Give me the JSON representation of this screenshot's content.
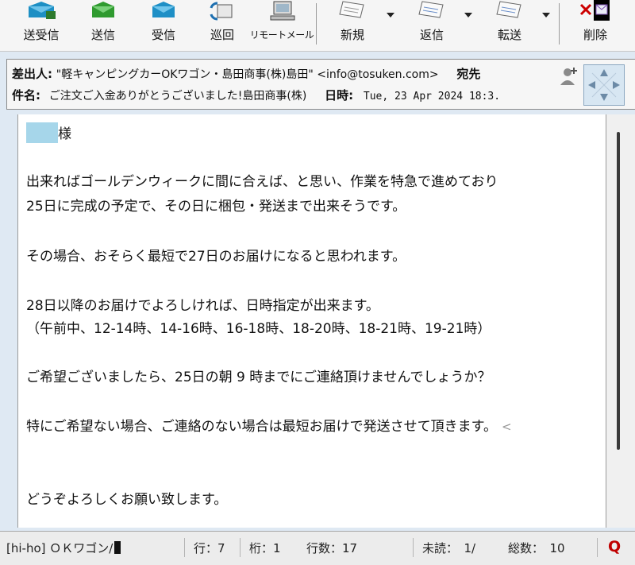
{
  "toolbar": {
    "buttons": [
      {
        "label": "送受信",
        "icon": "send-receive-icon"
      },
      {
        "label": "送信",
        "icon": "send-icon"
      },
      {
        "label": "受信",
        "icon": "receive-icon"
      },
      {
        "label": "巡回",
        "icon": "patrol-icon"
      },
      {
        "label": "リモートメール",
        "icon": "remote-mail-icon"
      },
      {
        "label": "新規",
        "icon": "new-mail-icon"
      },
      {
        "label": "返信",
        "icon": "reply-icon"
      },
      {
        "label": "転送",
        "icon": "forward-icon"
      },
      {
        "label": "削除",
        "icon": "delete-icon"
      }
    ]
  },
  "header": {
    "from_key": "差出人:",
    "from_value": "\"軽キャンピングカーOKワゴン・島田商事(株)島田\" <info@tosuken.com>",
    "to_key": "宛先",
    "subject_key": "件名:",
    "subject_value": "ご注文ご入金ありがとうございました!島田商事(株)",
    "date_key": "日時:",
    "date_value": "Tue, 23 Apr 2024 18:3."
  },
  "body": {
    "salutation": "様",
    "lines": [
      "出来ればゴールデンウィークに間に合えば、と思い、作業を特急で進めており",
      "25日に完成の予定で、その日に梱包・発送まで出来そうです。",
      "その場合、おそらく最短で27日のお届けになると思われます。",
      "28日以降のお届けでよろしければ、日時指定が出来ます。",
      "（午前中、12-14時、14-16時、16-18時、18-20時、18-21時、19-21時）",
      "ご希望ございましたら、25日の朝 9 時までにご連絡頂けませんでしょうか？",
      "特にご希望ない場合、ご連絡のない場合は最短お届けで発送させて頂きます。",
      "どうぞよろしくお願い致します。"
    ],
    "trailing_mark": "<"
  },
  "status": {
    "account": "[hi-ho] ＯＫワゴン/",
    "line": "行：7",
    "column": "桁：1",
    "line_count": "行数：17",
    "unread": "未読：　1/",
    "total": "総数：　10"
  },
  "colors": {
    "toolbar_bg": "#f5f5f5",
    "redaction": "#a6d6ea",
    "status_q": "#c00000"
  }
}
